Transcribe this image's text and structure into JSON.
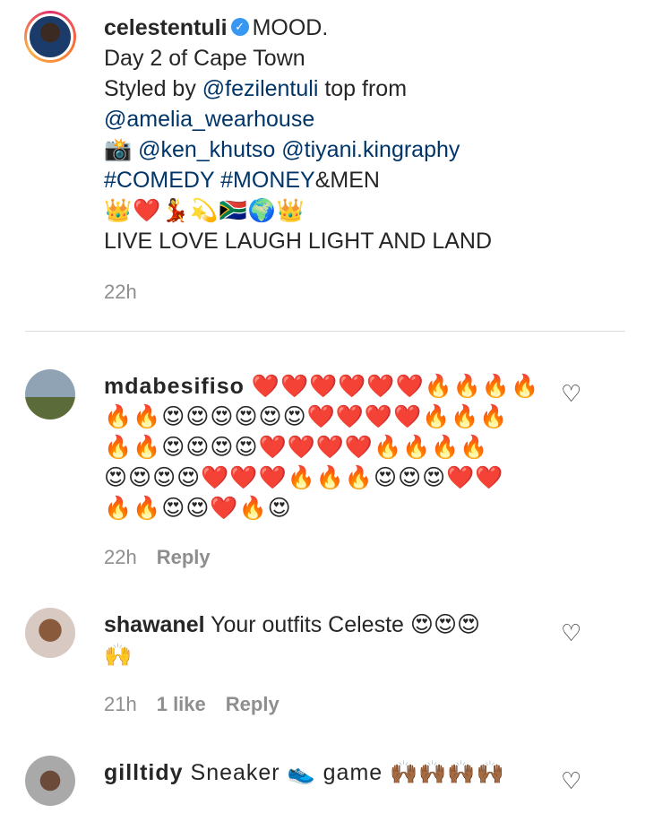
{
  "caption": {
    "username": "celestentuli",
    "line1": "MOOD.",
    "line2": "Day 2 of Cape Town",
    "line3_prefix": "Styled by ",
    "line3_mention": "@fezilentuli",
    "line3_suffix": " top from",
    "line4_mention": "@amelia_wearhouse",
    "line5_camera": "📸",
    "line5_mention1": "@ken_khutso",
    "line5_mention2": "@tiyani.kingraphy",
    "line6_tag1": "#COMEDY",
    "line6_tag2": "#MONEY",
    "line6_suffix": "&MEN",
    "line7_emojis": "👑❤️💃💫🇿🇦🌍👑",
    "line8": "LIVE LOVE LAUGH LIGHT AND LAND",
    "time": "22h"
  },
  "comments": [
    {
      "username": "mdabesifiso",
      "lines": [
        "❤️❤️❤️❤️❤️❤️🔥🔥🔥🔥",
        "🔥🔥😍😍😍😍😍😍❤️❤️❤️❤️🔥🔥🔥",
        "🔥🔥😍😍😍😍❤️❤️❤️❤️🔥🔥🔥🔥",
        "😍😍😍😍❤️❤️❤️🔥🔥🔥😍😍😍❤️❤️",
        "🔥🔥😍😍❤️🔥😍"
      ],
      "time": "22h",
      "reply": "Reply"
    },
    {
      "username": "shawanel",
      "text": "Your outfits Celeste 😍😍😍",
      "line2": "🙌",
      "time": "21h",
      "likes": "1 like",
      "reply": "Reply"
    },
    {
      "username": "gilltidy",
      "text": "Sneaker 👟 game 🙌🏾🙌🏾🙌🏾🙌🏾"
    }
  ],
  "icons": {
    "like": "heart-outline-icon",
    "verified": "verified-badge-icon"
  },
  "colors": {
    "mention": "#003569",
    "meta": "#8e8e8e",
    "verified": "#3897f0"
  }
}
